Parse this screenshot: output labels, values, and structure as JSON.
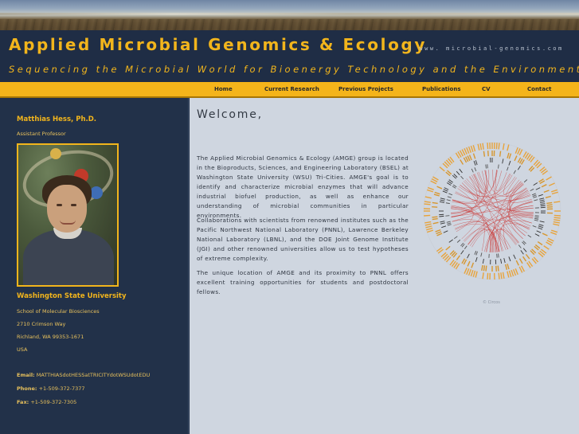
{
  "header": {
    "title": "Applied Microbial Genomics & Ecology",
    "url_text": "| www. microbial-genomics.com",
    "tagline": "Sequencing the Microbial World for Bioenergy Technology and the Environment"
  },
  "nav": {
    "items": [
      {
        "label": "Home"
      },
      {
        "label": "Current Research"
      },
      {
        "label": "Previous Projects"
      },
      {
        "label": "Publications"
      },
      {
        "label": "CV"
      },
      {
        "label": "Contact"
      }
    ]
  },
  "sidebar": {
    "name": "Matthias Hess, Ph.D.",
    "position": "Assistant Professor",
    "university": "Washington State University",
    "department": "School of Molecular Biosciences",
    "street": "2710 Crimson Way",
    "city": "Richland, WA 99353-1671",
    "country": "USA",
    "email_label": "Email:",
    "email_value": "MATTHIASdotHESSatTRICITYdotWSUdotEDU",
    "phone_label": "Phone:",
    "phone_value": "+1-509-372-7377",
    "fax_label": "Fax:",
    "fax_value": "+1-509-372-7305"
  },
  "main": {
    "heading": "Welcome,",
    "paragraphs": [
      "The Applied Microbial Genomics & Ecology (AMGE) group is located in the Bioproducts, Sciences, and Engineering Laboratory (BSEL) at Washington State University (WSU) Tri-Cities. AMGE's goal is to identify and characterize microbial enzymes that will advance industrial biofuel production, as well as enhance our understanding of microbial communities in particular environments.",
      "Collaborations with scientists from renowned institutes such as the Pacific Northwest National Laboratory (PNNL), Lawrence Berkeley National Laboratory (LBNL), and the DOE Joint Genome Institute (JGI) and other renowned universities allow us to test hypotheses of extreme complexity.",
      "The unique location of AMGE and its proximity to PNNL offers excellent training opportunities for students and postdoctoral fellows."
    ],
    "figure_caption": "© Circos"
  },
  "colors": {
    "accent": "#f2b51c",
    "header_bg": "#1f2d45",
    "content_bg": "#cfd6e0",
    "circos_links": "#c9302c"
  }
}
